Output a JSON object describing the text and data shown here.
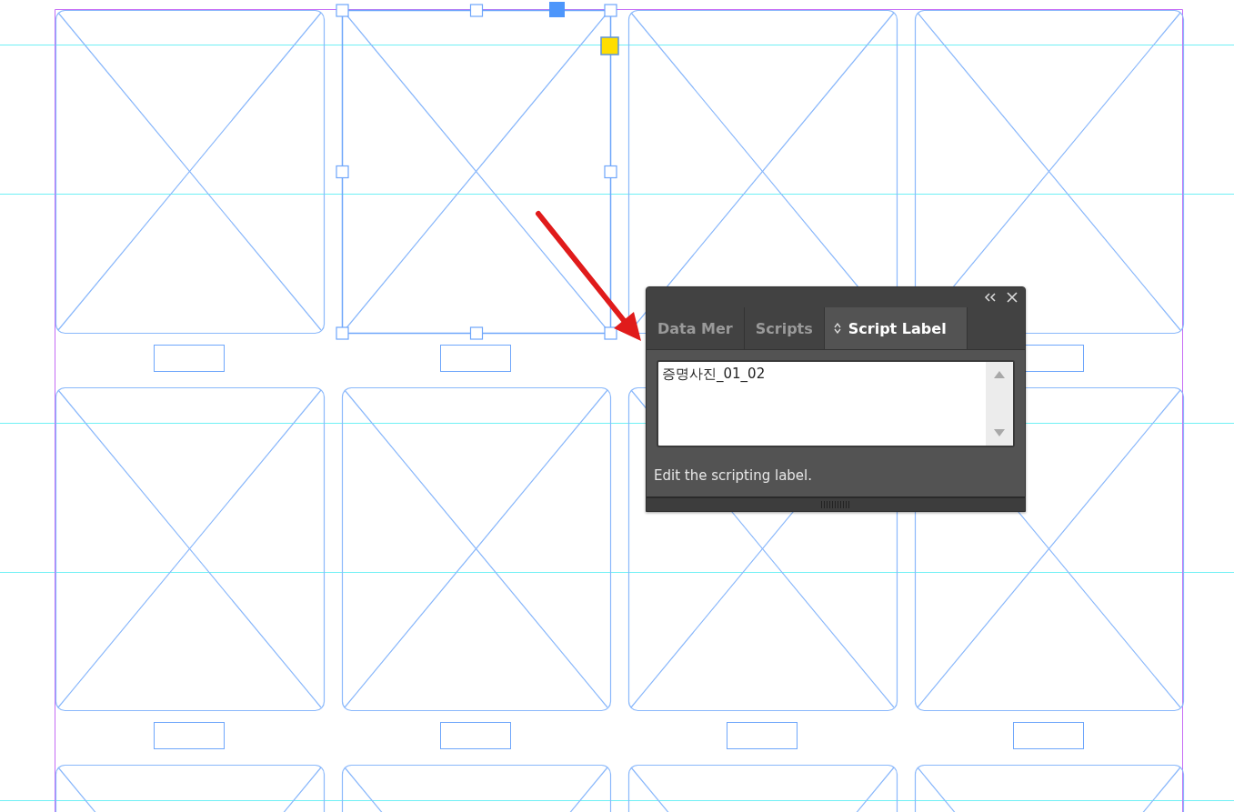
{
  "canvas": {
    "frames": [
      {
        "selected": false
      },
      {
        "selected": true
      },
      {
        "selected": false
      },
      {
        "selected": false
      },
      {
        "selected": false
      },
      {
        "selected": false
      },
      {
        "selected": false
      },
      {
        "selected": false
      },
      {
        "selected": false
      },
      {
        "selected": false
      },
      {
        "selected": false
      },
      {
        "selected": false
      }
    ]
  },
  "panel": {
    "tabs": [
      {
        "label": "Data Mer",
        "selected": false,
        "kind": "plain"
      },
      {
        "label": "Scripts",
        "selected": false,
        "kind": "plain"
      },
      {
        "label": "Script Label",
        "selected": true,
        "kind": "sortable"
      }
    ],
    "label_field": {
      "value": "증명사진_01_02"
    },
    "hint": "Edit the scripting label."
  }
}
